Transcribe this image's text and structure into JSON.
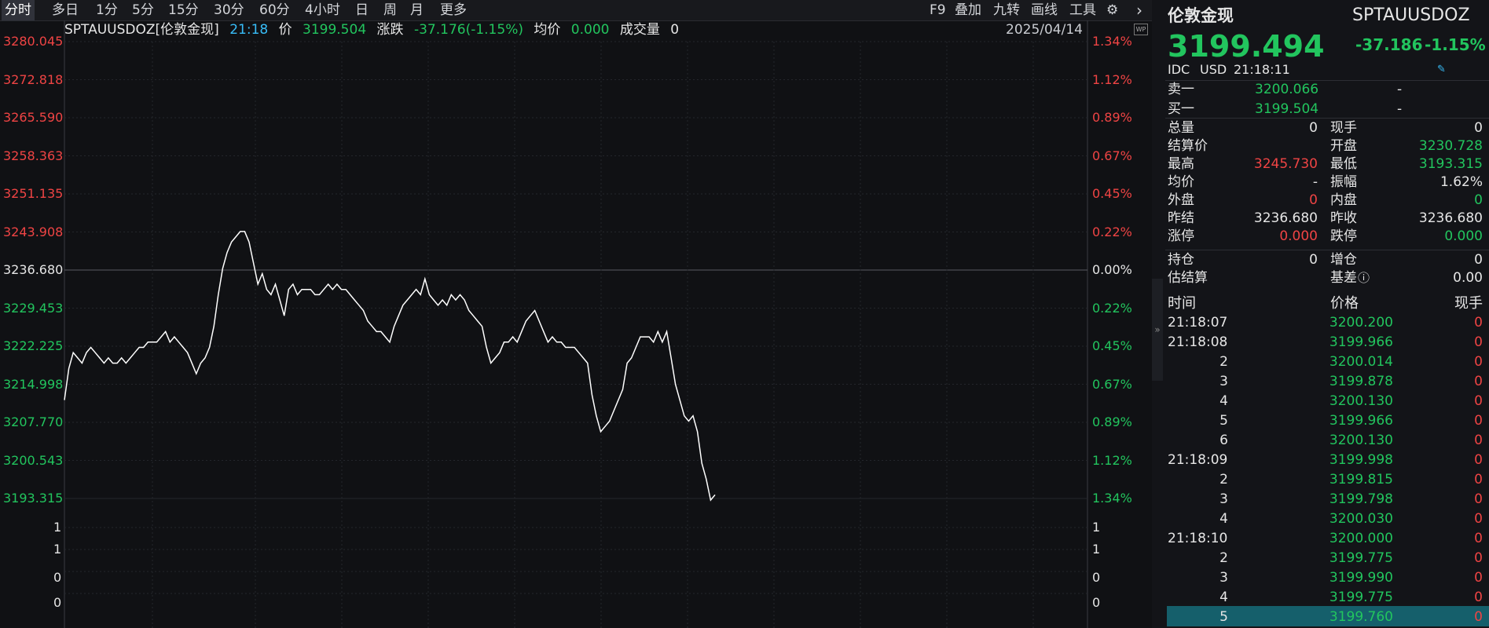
{
  "toolbar": {
    "periods": [
      "分时",
      "多日",
      "1分",
      "5分",
      "15分",
      "30分",
      "60分",
      "4小时",
      "日",
      "周",
      "月",
      "更多"
    ],
    "active_period": "分时",
    "tools": [
      "F9",
      "叠加",
      "九转",
      "画线",
      "工具"
    ],
    "gear_icon": "gear-icon",
    "expand_icon": "chevron-right-icon"
  },
  "info": {
    "symbol": "SPTAUUSDOZ[伦敦金现]",
    "time": "21:18",
    "price_label": "价",
    "price": "3199.504",
    "change_label": "涨跌",
    "change": "-37.176(-1.15%)",
    "avg_label": "均价",
    "avg": "0.000",
    "volume_label": "成交量",
    "volume": "0",
    "date": "2025/04/14",
    "wp_badge": "WP"
  },
  "axis": {
    "left_prices": [
      "3280.045",
      "3272.818",
      "3265.590",
      "3258.363",
      "3251.135",
      "3243.908",
      "3236.680",
      "3229.453",
      "3222.225",
      "3214.998",
      "3207.770",
      "3200.543",
      "3193.315"
    ],
    "right_pcts": [
      "1.34%",
      "1.12%",
      "0.89%",
      "0.67%",
      "0.45%",
      "0.22%",
      "0.00%",
      "0.22%",
      "0.45%",
      "0.67%",
      "0.89%",
      "1.12%",
      "1.34%"
    ],
    "volume_ticks": [
      "1",
      "1",
      "0",
      "0"
    ],
    "volume_ticks_right": [
      "1",
      "1",
      "0",
      "0"
    ]
  },
  "chart_data": {
    "type": "line",
    "series": [
      {
        "values": [
          3212,
          3218,
          3221,
          3220,
          3219,
          3221,
          3222,
          3221,
          3220,
          3219,
          3220,
          3219,
          3219,
          3220,
          3219,
          3220,
          3221,
          3222,
          3222,
          3223,
          3223,
          3223,
          3224,
          3225,
          3223,
          3224,
          3223,
          3222,
          3221,
          3219,
          3217,
          3219,
          3220,
          3222,
          3226,
          3232,
          3237,
          3240,
          3242,
          3243,
          3244,
          3244,
          3242,
          3238,
          3234,
          3236,
          3233,
          3232,
          3234,
          3231,
          3228,
          3233,
          3234,
          3232,
          3233,
          3233,
          3233,
          3232,
          3232,
          3233,
          3234,
          3233,
          3234,
          3233,
          3233,
          3232,
          3231,
          3230,
          3229,
          3227,
          3226,
          3225,
          3225,
          3224,
          3223,
          3226,
          3228,
          3230,
          3231,
          3232,
          3233,
          3232,
          3235,
          3232,
          3231,
          3230,
          3231,
          3230,
          3232,
          3231,
          3232,
          3231,
          3229,
          3228,
          3227,
          3226,
          3222,
          3219,
          3220,
          3221,
          3223,
          3223,
          3224,
          3223,
          3225,
          3227,
          3228,
          3229,
          3227,
          3225,
          3223,
          3224,
          3223,
          3223,
          3222,
          3222,
          3222,
          3221,
          3220,
          3219,
          3213,
          3209,
          3206,
          3207,
          3208,
          3210,
          3212,
          3214,
          3219,
          3220,
          3222,
          3224,
          3224,
          3224,
          3223,
          3225,
          3223,
          3225,
          3220,
          3215,
          3212,
          3209,
          3208,
          3209,
          3206,
          3200,
          3197,
          3193,
          3194
        ]
      }
    ],
    "ylim": [
      3193.315,
      3280.045
    ]
  },
  "quote": {
    "name": "伦敦金现",
    "code": "SPTAUUSDOZ",
    "price": "3199.494",
    "change": "-37.186",
    "change_pct": "-1.15%",
    "exchange": "IDC",
    "currency": "USD",
    "time": "21:18:11",
    "edit_icon": "pencil-icon",
    "sell1_label": "卖一",
    "sell1_price": "3200.066",
    "sell1_vol": "-",
    "buy1_label": "买一",
    "buy1_price": "3199.504",
    "buy1_vol": "-",
    "fields": [
      {
        "l1": "总量",
        "v1": "0",
        "l2": "现手",
        "v2": "0"
      },
      {
        "l1": "结算价",
        "v1": "",
        "l2": "开盘",
        "v2": "3230.728"
      },
      {
        "l1": "最高",
        "v1": "3245.730",
        "l2": "最低",
        "v2": "3193.315"
      },
      {
        "l1": "均价",
        "v1": "-",
        "l2": "振幅",
        "v2": "1.62%"
      },
      {
        "l1": "外盘",
        "v1": "0",
        "l2": "内盘",
        "v2": "0"
      },
      {
        "l1": "昨结",
        "v1": "3236.680",
        "l2": "昨收",
        "v2": "3236.680"
      },
      {
        "l1": "涨停",
        "v1": "0.000",
        "l2": "跌停",
        "v2": "0.000"
      }
    ],
    "fields2": [
      {
        "l1": "持仓",
        "v1": "0",
        "l2": "增仓",
        "v2": "0"
      },
      {
        "l1": "估结算",
        "v1": "",
        "l2": "基差",
        "v2": "0.00"
      }
    ],
    "info_icon": "info-circle-icon",
    "ticks_header": {
      "time": "时间",
      "price": "价格",
      "vol": "现手"
    },
    "ticks": [
      {
        "t": "21:18:07",
        "p": "3200.200",
        "v": "0"
      },
      {
        "t": "21:18:08",
        "p": "3199.966",
        "v": "0"
      },
      {
        "t": "2",
        "p": "3200.014",
        "v": "0"
      },
      {
        "t": "3",
        "p": "3199.878",
        "v": "0"
      },
      {
        "t": "4",
        "p": "3200.130",
        "v": "0"
      },
      {
        "t": "5",
        "p": "3199.966",
        "v": "0"
      },
      {
        "t": "6",
        "p": "3200.130",
        "v": "0"
      },
      {
        "t": "21:18:09",
        "p": "3199.998",
        "v": "0"
      },
      {
        "t": "2",
        "p": "3199.815",
        "v": "0"
      },
      {
        "t": "3",
        "p": "3199.798",
        "v": "0"
      },
      {
        "t": "4",
        "p": "3200.030",
        "v": "0"
      },
      {
        "t": "21:18:10",
        "p": "3200.000",
        "v": "0"
      },
      {
        "t": "2",
        "p": "3199.775",
        "v": "0"
      },
      {
        "t": "3",
        "p": "3199.990",
        "v": "0"
      },
      {
        "t": "4",
        "p": "3199.775",
        "v": "0"
      },
      {
        "t": "5",
        "p": "3199.760",
        "v": "0"
      }
    ]
  },
  "colors": {
    "up": "#ef4444",
    "down": "#22c55e",
    "bg": "#101114",
    "line": "#ffffff",
    "grid": "#2a2c31"
  }
}
